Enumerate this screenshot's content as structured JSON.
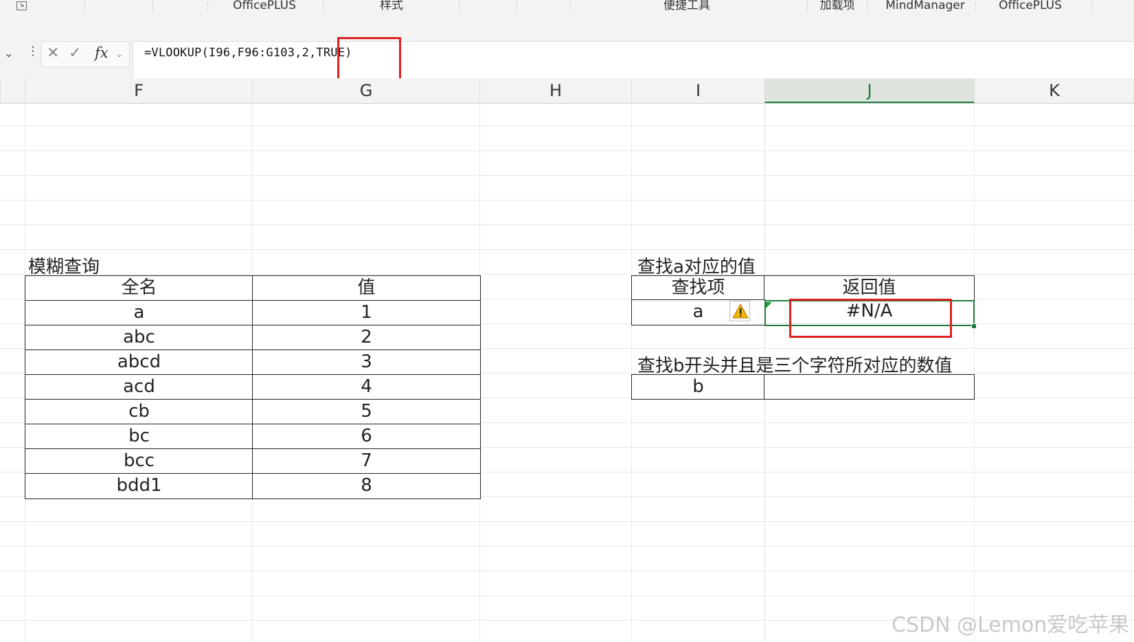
{
  "ribbon": {
    "groups": [
      "OfficePLUS",
      "样式",
      "便捷工具",
      "加载项",
      "MindManager",
      "OfficePLUS"
    ]
  },
  "formula_bar": {
    "cancel_icon": "cross-icon",
    "enter_icon": "check-icon",
    "fx_label": "fx",
    "formula": "=VLOOKUP(I96,F96:G103,2,TRUE)"
  },
  "columns": [
    "F",
    "G",
    "H",
    "I",
    "J",
    "K"
  ],
  "active_column": "J",
  "fuzzy_table": {
    "title": "模糊查询",
    "headers": [
      "全名",
      "值"
    ],
    "rows": [
      [
        "a",
        "1"
      ],
      [
        "abc",
        "2"
      ],
      [
        "abcd",
        "3"
      ],
      [
        "acd",
        "4"
      ],
      [
        "cb",
        "5"
      ],
      [
        "bc",
        "6"
      ],
      [
        "bcc",
        "7"
      ],
      [
        "bdd1",
        "8"
      ]
    ]
  },
  "lookup_a": {
    "title": "查找a对应的值",
    "headers": [
      "查找项",
      "返回值"
    ],
    "lookup_value": "a",
    "result": "#N/A",
    "warning_icon": "warning-icon"
  },
  "lookup_b": {
    "title": "查找b开头并且是三个字符所对应的数值",
    "lookup_value": "b",
    "result": ""
  },
  "watermark": "CSDN @Lemon爱吃苹果",
  "colors": {
    "highlight_red": "#e02020",
    "selection_green": "#1e7b3c",
    "error_indicator": "#1e9a3c"
  }
}
